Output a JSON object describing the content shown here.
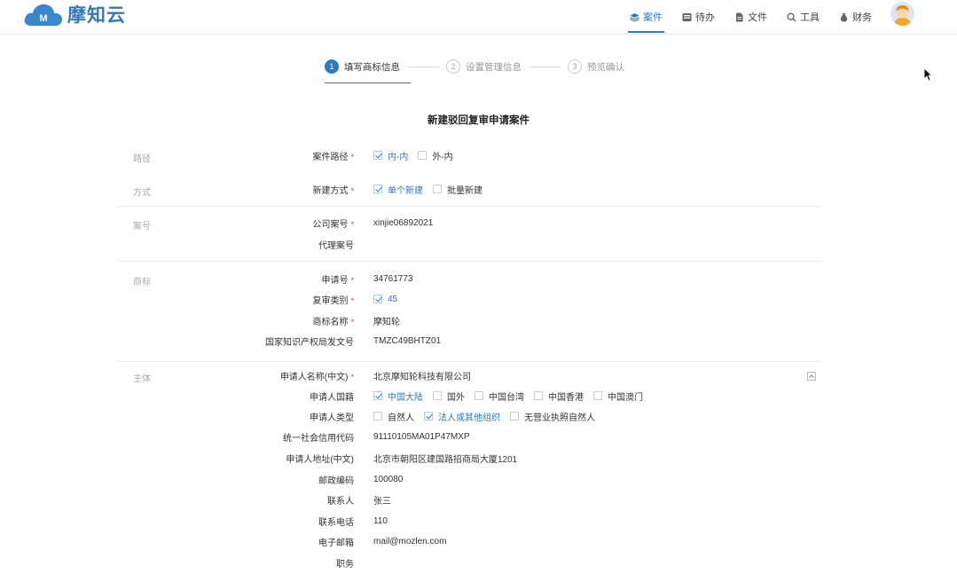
{
  "app": {
    "logo_text": "摩知云",
    "logo_mark": "M"
  },
  "nav": [
    {
      "label": "案件",
      "icon": "layers-icon",
      "active": true
    },
    {
      "label": "待办",
      "icon": "inbox-icon",
      "active": false
    },
    {
      "label": "文件",
      "icon": "file-icon",
      "active": false
    },
    {
      "label": "工具",
      "icon": "search-icon",
      "active": false
    },
    {
      "label": "财务",
      "icon": "money-bag-icon",
      "active": false
    }
  ],
  "steps": [
    {
      "num": "1",
      "label": "填写商标信息",
      "active": true
    },
    {
      "num": "2",
      "label": "设置管理信息",
      "active": false
    },
    {
      "num": "3",
      "label": "预览确认",
      "active": false
    }
  ],
  "form_title": "新建驳回复审申请案件",
  "sections": {
    "route": "路径",
    "method": "方式",
    "case_no": "案号",
    "trademark": "商标",
    "subject": "主体"
  },
  "fields": {
    "case_route": {
      "label": "案件路径",
      "options": [
        {
          "label": "内-内",
          "checked": true
        },
        {
          "label": "外-内",
          "checked": false
        }
      ]
    },
    "create_method": {
      "label": "新建方式",
      "options": [
        {
          "label": "单个新建",
          "checked": true
        },
        {
          "label": "批量新建",
          "checked": false
        }
      ]
    },
    "company_case_no": {
      "label": "公司案号",
      "value": "xinjie06892021"
    },
    "agent_case_no": {
      "label": "代理案号",
      "value": ""
    },
    "application_no": {
      "label": "申请号",
      "value": "34761773"
    },
    "review_class": {
      "label": "复审类别",
      "options": [
        {
          "label": "45",
          "checked": true
        }
      ]
    },
    "trademark_name": {
      "label": "商标名称",
      "value": "摩知轮"
    },
    "cnipa_doc_no": {
      "label": "国家知识产权局发文号",
      "value": "TMZC49BHTZ01"
    },
    "applicant_name_cn": {
      "label": "申请人名称(中文)",
      "value": "北京摩知轮科技有限公司"
    },
    "applicant_nationality": {
      "label": "申请人国籍",
      "options": [
        {
          "label": "中国大陆",
          "checked": true
        },
        {
          "label": "国外",
          "checked": false
        },
        {
          "label": "中国台湾",
          "checked": false
        },
        {
          "label": "中国香港",
          "checked": false
        },
        {
          "label": "中国澳门",
          "checked": false
        }
      ]
    },
    "applicant_type": {
      "label": "申请人类型",
      "options": [
        {
          "label": "自然人",
          "checked": false
        },
        {
          "label": "法人或其他组织",
          "checked": true
        },
        {
          "label": "无营业执照自然人",
          "checked": false
        }
      ]
    },
    "credit_code": {
      "label": "统一社会信用代码",
      "value": "91110105MA01P47MXP"
    },
    "address_cn": {
      "label": "申请人地址(中文)",
      "value": "北京市朝阳区建国路招商局大厦1201"
    },
    "postal_code": {
      "label": "邮政编码",
      "value": "100080"
    },
    "contact": {
      "label": "联系人",
      "value": "张三"
    },
    "phone": {
      "label": "联系电话",
      "value": "110"
    },
    "email": {
      "label": "电子邮箱",
      "value": "mail@mozlen.com"
    },
    "position": {
      "label": "职务",
      "value": ""
    }
  },
  "colors": {
    "primary": "#2f79c2",
    "required": "#e4393c"
  }
}
